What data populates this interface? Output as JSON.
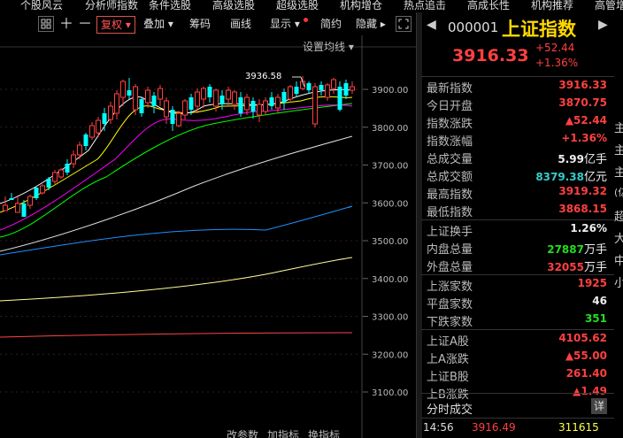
{
  "top_nav": [
    "个股风云",
    "分析师指数",
    "条件选股",
    "高级选股",
    "超级选股",
    "机构增仓",
    "热点追击",
    "高成长性",
    "机构推荐",
    "高管增"
  ],
  "toolbar": {
    "fuquan": "复权",
    "diejia": "叠加",
    "choujiao": "筹码",
    "huaxian": "画线",
    "xianshi": "显示",
    "jianyue": "简约",
    "yincang": "隐藏"
  },
  "chart_overlay": {
    "set_ma": "设置均线",
    "high_label": "3936.58"
  },
  "y_axis": [
    "3900.00",
    "3800.00",
    "3700.00",
    "3600.00",
    "3500.00",
    "3400.00",
    "3300.00",
    "3200.00",
    "3100.00"
  ],
  "bottom_bar": [
    "改参数",
    "加指标",
    "换指标"
  ],
  "index": {
    "code": "000001",
    "name": "上证指数",
    "price": "3916.33",
    "change": "+52.44",
    "change_pct": "+1.36%"
  },
  "quote_rows": [
    {
      "label": "最新指数",
      "value": "3916.33",
      "unit": "",
      "color": "rr"
    },
    {
      "label": "今日开盘",
      "value": "3870.75",
      "unit": "",
      "color": "rr"
    },
    {
      "label": "指数涨跌",
      "value": "▲52.44",
      "unit": "",
      "color": "rr"
    },
    {
      "label": "指数涨幅",
      "value": "+1.36%",
      "unit": "",
      "color": "rr"
    },
    {
      "label": "总成交量",
      "value": "5.99",
      "unit": "亿手",
      "color": "ww"
    },
    {
      "label": "总成交额",
      "value": "8379.38",
      "unit": "亿元",
      "color": "cc"
    },
    {
      "label": "最高指数",
      "value": "3919.32",
      "unit": "",
      "color": "rr"
    },
    {
      "label": "最低指数",
      "value": "3868.15",
      "unit": "",
      "color": "rr"
    },
    {
      "label": "上证换手",
      "value": "1.26%",
      "unit": "",
      "color": "ww"
    },
    {
      "label": "内盘总量",
      "value": "27887",
      "unit": "万手",
      "color": "gg"
    },
    {
      "label": "外盘总量",
      "value": "32055",
      "unit": "万手",
      "color": "rr"
    },
    {
      "label": "上涨家数",
      "value": "1925",
      "unit": "",
      "color": "rr"
    },
    {
      "label": "平盘家数",
      "value": "46",
      "unit": "",
      "color": "ww"
    },
    {
      "label": "下跌家数",
      "value": "351",
      "unit": "",
      "color": "gg"
    },
    {
      "label": "上证A股",
      "value": "4105.62",
      "unit": "",
      "color": "rr"
    },
    {
      "label": "上A涨跌",
      "value": "▲55.00",
      "unit": "",
      "color": "rr"
    },
    {
      "label": "上证B股",
      "value": "261.40",
      "unit": "",
      "color": "rr"
    },
    {
      "label": "上B涨跌",
      "value": "▲1.49",
      "unit": "",
      "color": "rr"
    }
  ],
  "fenshi": {
    "title": "分时成交",
    "detail": "详",
    "time": "14:56",
    "price": "3916.49",
    "volume": "311615"
  },
  "edge_chars": [
    "主",
    "主",
    "主",
    "(亿",
    "超",
    "大",
    "中",
    "小"
  ],
  "colors": {
    "up": "#ff4040",
    "down": "#00ffff",
    "ma5": "#ffffff",
    "ma10": "#ffff00",
    "ma20": "#ff00ff",
    "ma30": "#00ff00",
    "ma60": "#dddddd",
    "ma120": "#1e90ff",
    "ma250": "#ffff99",
    "ma500": "#ff4444"
  }
}
